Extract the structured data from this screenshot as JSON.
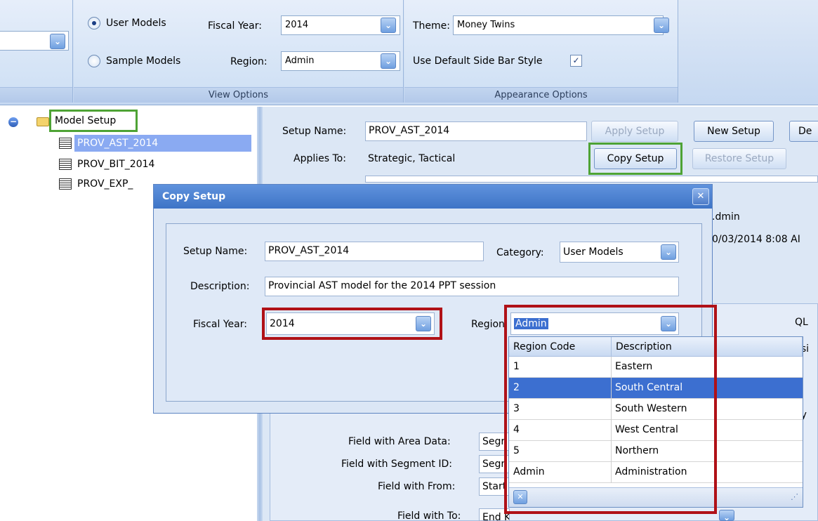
{
  "ribbon": {
    "view_options": {
      "user_models": "User Models",
      "sample_models": "Sample Models",
      "fiscal_year_label": "Fiscal Year:",
      "fiscal_year_value": "2014",
      "region_label": "Region:",
      "region_value": "Admin",
      "group_label": "View Options"
    },
    "appearance_options": {
      "theme_label": "Theme:",
      "theme_value": "Money Twins",
      "default_side_bar": "Use Default Side Bar Style",
      "group_label": "Appearance Options"
    }
  },
  "tree": {
    "root": "Model Setup",
    "items": [
      "PROV_AST_2014",
      "PROV_BIT_2014",
      "PROV_EXP_"
    ]
  },
  "setup": {
    "setup_name_label": "Setup Name:",
    "setup_name_value": "PROV_AST_2014",
    "applies_to_label": "Applies To:",
    "applies_to_value": "Strategic, Tactical",
    "apply_setup": "Apply Setup",
    "new_setup": "New Setup",
    "de_cut": "De",
    "copy_setup": "Copy Setup",
    "restore_setup": "Restore Setup",
    "admin_cut": ".dmin",
    "date_cut": "0/03/2014 8:08 AI",
    "ql_cut": "QL",
    "usi_cut": "usi",
    "ay_cut": "ay",
    "fields": [
      {
        "label": "Field with Area Data:",
        "value": "Segr"
      },
      {
        "label": "Field with Segment ID:",
        "value": "Segr"
      },
      {
        "label": "Field with From:",
        "value": "Start"
      },
      {
        "label": "Field with To:",
        "value": "End Km"
      }
    ]
  },
  "dialog": {
    "title": "Copy Setup",
    "setup_name_label": "Setup Name:",
    "setup_name_value": "PROV_AST_2014",
    "category_label": "Category:",
    "category_value": "User Models",
    "description_label": "Description:",
    "description_value": "Provincial AST model for the 2014 PPT session",
    "fiscal_year_label": "Fiscal Year:",
    "fiscal_year_value": "2014",
    "region_label": "Region:",
    "region_value": "Admin"
  },
  "region_dropdown": {
    "columns": [
      "Region Code",
      "Description"
    ],
    "rows": [
      {
        "code": "1",
        "desc": "Eastern"
      },
      {
        "code": "2",
        "desc": "South Central"
      },
      {
        "code": "3",
        "desc": "South Western"
      },
      {
        "code": "4",
        "desc": "West Central"
      },
      {
        "code": "5",
        "desc": "Northern"
      },
      {
        "code": "Admin",
        "desc": "Administration"
      }
    ],
    "selected_index": 1
  },
  "colors": {
    "highlight_green": "#4ea335",
    "highlight_red": "#b01117",
    "selection_blue": "#3c6fd0"
  }
}
